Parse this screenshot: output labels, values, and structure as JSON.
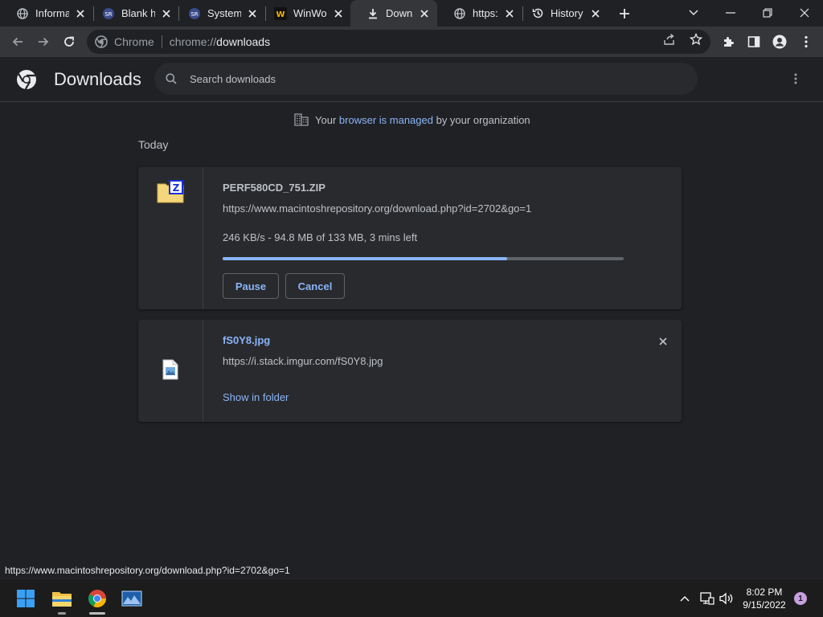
{
  "tabs": [
    {
      "label": "Informa",
      "icon": "globe-icon"
    },
    {
      "label": "Blank ha",
      "icon": "site-favicon-icon"
    },
    {
      "label": "System",
      "icon": "site-favicon-icon"
    },
    {
      "label": "WinWo",
      "icon": "winworld-favicon-icon"
    },
    {
      "label": "Downlo",
      "icon": "download-icon",
      "active": true
    },
    {
      "label": "https://\\",
      "icon": "globe-icon"
    },
    {
      "label": "History",
      "icon": "history-icon"
    }
  ],
  "omnibox": {
    "chip": "Chrome",
    "url_scheme": "chrome://",
    "url_host": "downloads"
  },
  "page": {
    "title": "Downloads",
    "search_placeholder": "Search downloads"
  },
  "managed": {
    "prefix": "Your",
    "link": "browser is managed",
    "suffix": "by your organization"
  },
  "section": {
    "date": "Today"
  },
  "downloads": [
    {
      "filename": "PERF580CD_751.ZIP",
      "url": "https://www.macintoshrepository.org/download.php?id=2702&go=1",
      "status": "246 KB/s - 94.8 MB of 133 MB, 3 mins left",
      "progress": 0.71,
      "pause_label": "Pause",
      "cancel_label": "Cancel",
      "icon": "zip-file-icon"
    },
    {
      "filename": "fS0Y8.jpg",
      "url": "https://i.stack.imgur.com/fS0Y8.jpg",
      "show_in_folder_label": "Show in folder",
      "icon": "image-file-icon"
    }
  ],
  "status_bubble": "https://www.macintoshrepository.org/download.php?id=2702&go=1",
  "taskbar": {
    "time": "8:02 PM",
    "date": "9/15/2022",
    "notification_count": "1"
  },
  "colors": {
    "accent": "#8ab4f8",
    "background": "#202124",
    "card": "#292a2d"
  }
}
